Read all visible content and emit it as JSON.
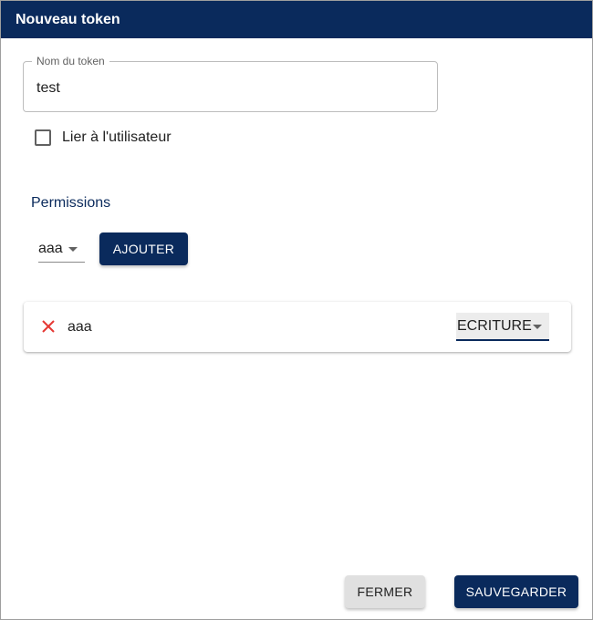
{
  "dialog": {
    "title": "Nouveau token"
  },
  "token_name": {
    "label": "Nom du token",
    "value": "test"
  },
  "bind_user": {
    "label": "Lier à l'utilisateur",
    "checked": false
  },
  "permissions": {
    "title": "Permissions",
    "selector_value": "aaa",
    "add_label": "AJOUTER",
    "items": [
      {
        "name": "aaa",
        "access": "ECRITURE"
      }
    ]
  },
  "footer": {
    "close_label": "FERMER",
    "save_label": "SAUVEGARDER"
  },
  "colors": {
    "primary": "#0a2a5c",
    "remove": "#e53935"
  },
  "icons": {
    "remove": "close-icon",
    "dropdown": "caret-down-icon"
  }
}
